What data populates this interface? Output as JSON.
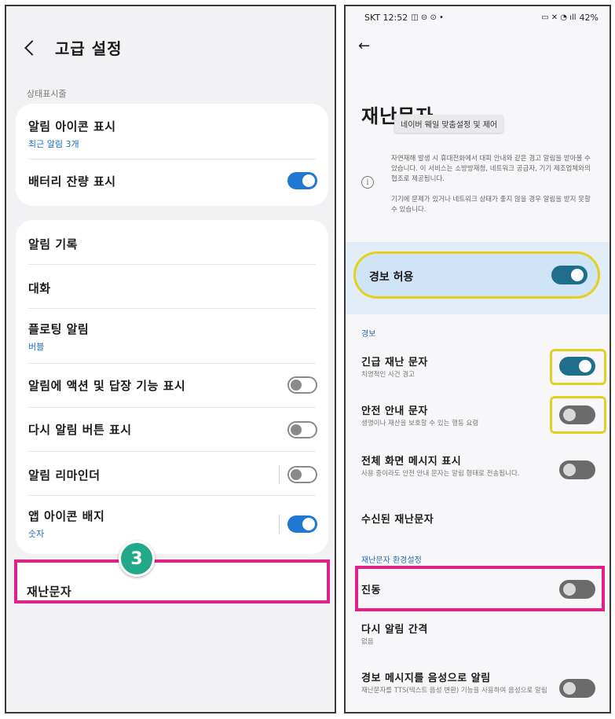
{
  "left": {
    "header": {
      "title": "고급 설정"
    },
    "section_label": "상태표시줄",
    "card1": {
      "items": [
        {
          "title": "알림 아이콘 표시",
          "subtitle": "최근 알림 3개"
        },
        {
          "title": "배터리 잔량 표시",
          "toggle": "on"
        }
      ]
    },
    "card2": {
      "items": [
        {
          "title": "알림 기록"
        },
        {
          "title": "대화"
        },
        {
          "title": "플로팅 알림",
          "subtitle": "버블"
        },
        {
          "title": "알림에 액션 및 답장 기능 표시",
          "toggle": "off"
        },
        {
          "title": "다시 알림 버튼 표시",
          "toggle": "off"
        },
        {
          "title": "알림 리마인더",
          "toggle": "off"
        },
        {
          "title": "앱 아이콘 배지",
          "subtitle": "숫자",
          "toggle": "on"
        }
      ]
    },
    "highlight": {
      "title": "재난문자"
    },
    "step_badge": "3"
  },
  "right": {
    "status_bar": {
      "carrier_time": "SKT 12:52",
      "battery": "42%"
    },
    "title": "재난문자",
    "tooltip": "네이버 웨일 맞춤설정 및 제어",
    "info_text_1": "자연재해 발생 시 휴대전화에서 대피 안내와 같은 경고 알림을 받아볼 수 있습니다. 이 서비스는 소방방재청, 네트워크 공급자, 기기 제조업체와의 협조로 제공됩니다.",
    "info_text_2": "기기에 문제가 있거나 네트워크 상태가 좋지 않을 경우 알림을 받지 못할 수 있습니다.",
    "allow": {
      "label": "경보 허용",
      "toggle": "on"
    },
    "section_alerts": "경보",
    "alerts": [
      {
        "title": "긴급 재난 문자",
        "subtitle": "치명적인 사건 경고",
        "toggle": "on"
      },
      {
        "title": "안전 안내 문자",
        "subtitle": "생명이나 재산을 보호할 수 있는 행동 요령",
        "toggle": "off"
      },
      {
        "title": "전체 화면 메시지 표시",
        "subtitle": "사용 중이라도 안전 안내 문자는 알림 형태로 전송됩니다.",
        "toggle": "off"
      },
      {
        "title": "수신된 재난문자"
      }
    ],
    "section_settings": "재난문자 환경설정",
    "settings": [
      {
        "title": "진동",
        "toggle": "off"
      },
      {
        "title": "다시 알림 간격",
        "subtitle": "없음"
      },
      {
        "title": "경보 메시지를 음성으로 알림",
        "subtitle": "재난문자를 TTS(텍스트 음성 변환) 기능을 사용하여 음성으로 알림",
        "toggle": "off"
      }
    ]
  }
}
